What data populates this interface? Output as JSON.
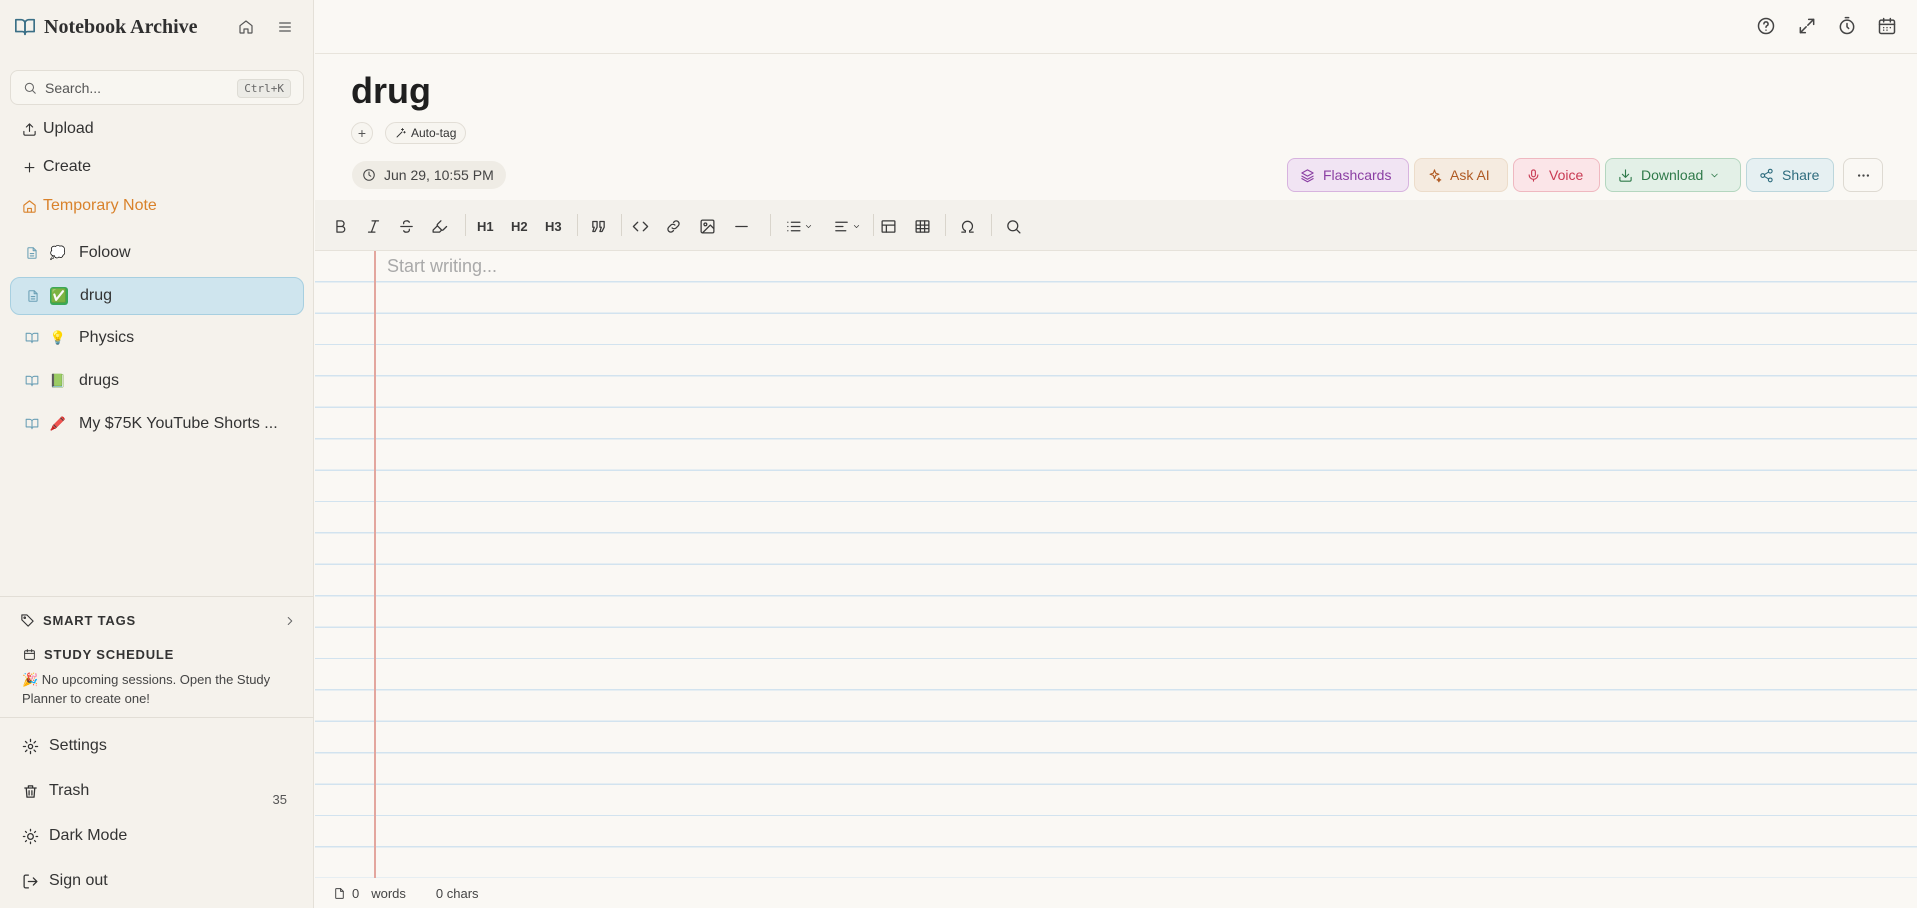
{
  "app": {
    "title": "Notebook Archive",
    "accent_color": "#3a6f86",
    "header_icons": [
      "home-icon",
      "menu-icon"
    ]
  },
  "search": {
    "placeholder": "Search...",
    "shortcut": "Ctrl+K"
  },
  "nav": {
    "upload": "Upload",
    "create": "Create",
    "temporary_note": "Temporary Note"
  },
  "notes": [
    {
      "emoji": "💭",
      "label": "Foloow",
      "type": "page",
      "active": false
    },
    {
      "emoji": "✅",
      "label": "drug",
      "type": "page",
      "active": true
    },
    {
      "emoji": "💡",
      "label": "Physics",
      "type": "notebook",
      "active": false
    },
    {
      "emoji": "📗",
      "label": "drugs",
      "type": "notebook",
      "active": false
    },
    {
      "emoji": "🖍️",
      "label": "My $75K YouTube Shorts ...",
      "type": "notebook",
      "active": false
    }
  ],
  "smart_tags": {
    "title": "SMART TAGS"
  },
  "study_schedule": {
    "title": "STUDY SCHEDULE",
    "message": "🎉 No upcoming sessions. Open the Study Planner to create one!"
  },
  "footer": {
    "settings": "Settings",
    "trash": "Trash",
    "trash_count": "35",
    "dark_mode": "Dark Mode",
    "sign_out": "Sign out"
  },
  "topbar_icons": [
    "help-icon",
    "expand-icon",
    "timer-icon",
    "calendar-icon"
  ],
  "document": {
    "title": "drug",
    "tag_add": "+",
    "auto_tag": "Auto-tag",
    "date": "Jun 29, 10:55 PM",
    "placeholder": "Start writing..."
  },
  "actions": {
    "flashcards": "Flashcards",
    "ask_ai": "Ask AI",
    "voice": "Voice",
    "download": "Download",
    "share": "Share"
  },
  "toolbar": {
    "h1": "H1",
    "h2": "H2",
    "h3": "H3",
    "buttons": [
      "bold",
      "italic",
      "strikethrough",
      "highlight",
      "heading-1",
      "heading-2",
      "heading-3",
      "blockquote",
      "code",
      "link",
      "image",
      "horizontal-rule",
      "bullet-list",
      "align",
      "table",
      "table-grid",
      "special-character",
      "find"
    ]
  },
  "status": {
    "words_count": "0",
    "words_label": "words",
    "chars": "0 chars"
  },
  "colors": {
    "flashcards": "#8b3fa3",
    "ask_ai": "#b05a23",
    "voice": "#c93a53",
    "download": "#2f7a4a",
    "share": "#2f6c7e",
    "temporary_note": "#d9822b",
    "active_note_bg": "#cfe5ee"
  }
}
